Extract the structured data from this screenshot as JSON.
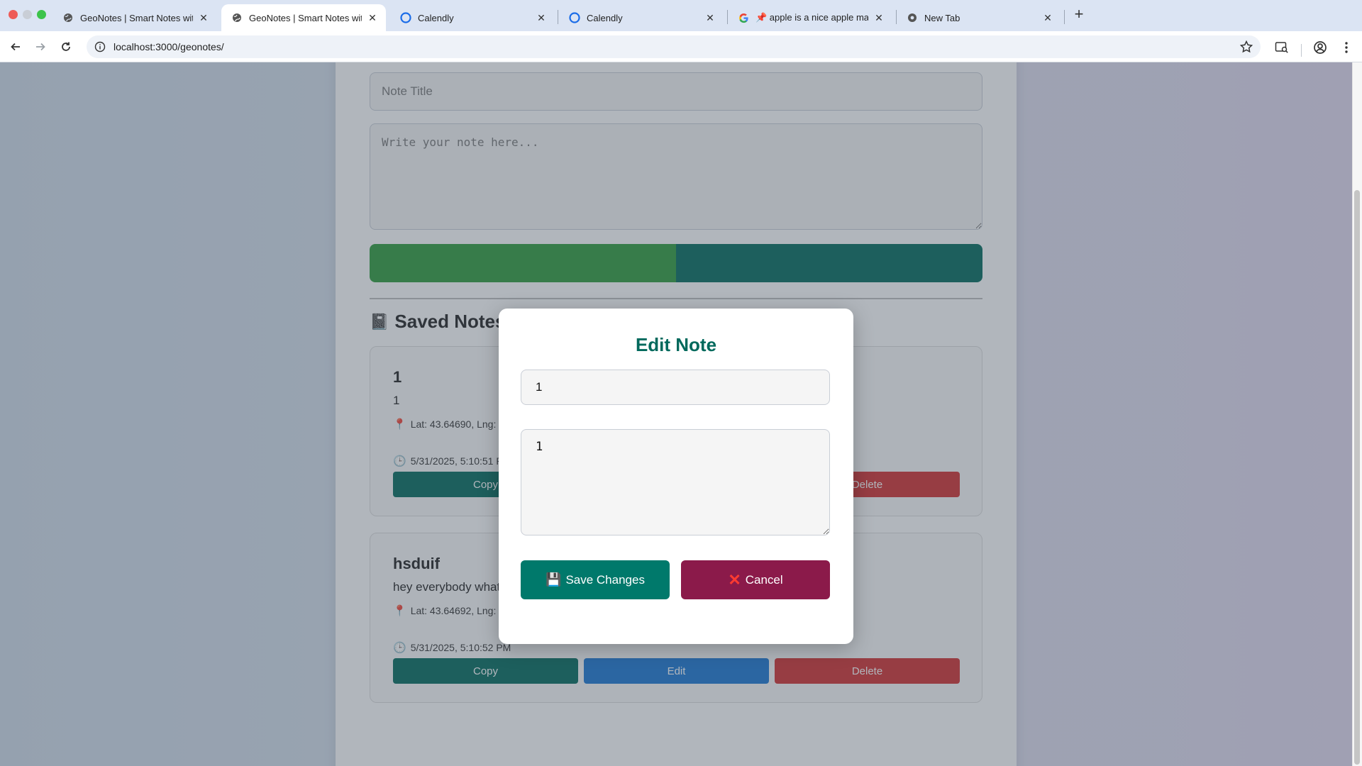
{
  "browser": {
    "tabs": [
      {
        "title": "GeoNotes | Smart Notes with",
        "favicon": "globe-icon",
        "active": false
      },
      {
        "title": "GeoNotes | Smart Notes with",
        "favicon": "globe-icon",
        "active": true
      },
      {
        "title": "Calendly",
        "favicon": "calendly-icon",
        "active": false
      },
      {
        "title": "Calendly",
        "favicon": "calendly-icon",
        "active": false
      },
      {
        "title": "📌 apple is a nice apple mang",
        "favicon": "google-icon",
        "active": false
      },
      {
        "title": "New Tab",
        "favicon": "chrome-icon",
        "active": false
      }
    ],
    "new_tab_label": "+",
    "close_glyph": "✕",
    "url": "localhost:3000/geonotes/"
  },
  "form": {
    "title_placeholder": "Note Title",
    "body_placeholder": "Write your note here..."
  },
  "saved_notes": {
    "heading_icon": "📓",
    "heading": "Saved Notes",
    "notes": [
      {
        "title": "1",
        "body": "1",
        "location": "Lat: 43.64690, Lng: -",
        "timestamp": "5/31/2025, 5:10:51 P",
        "copy_label": "Copy",
        "delete_label": "Delete"
      },
      {
        "title": "hsduif",
        "body": "hey everybody what is happening",
        "location": "Lat: 43.64692, Lng: -79.75756",
        "timestamp": "5/31/2025, 5:10:52 PM",
        "copy_label": "Copy",
        "edit_label": "Edit",
        "delete_label": "Delete"
      }
    ]
  },
  "modal": {
    "title": "Edit Note",
    "title_value": "1",
    "body_value": "1",
    "save_icon": "💾",
    "save_label": "Save Changes",
    "cancel_icon": "✕",
    "cancel_label": "Cancel"
  },
  "colors": {
    "accent": "#00695c",
    "edit_blue": "#1976d2",
    "delete_red": "#d32f2f",
    "cancel_maroon": "#8b1a4a"
  }
}
